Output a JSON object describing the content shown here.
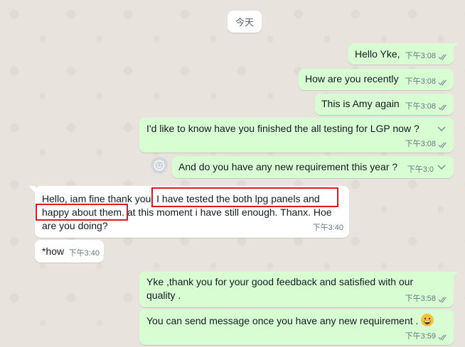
{
  "chat": {
    "date_chip": "今天",
    "messages": [
      {
        "dir": "out",
        "text": "Hello Yke,",
        "time": "下午3:08"
      },
      {
        "dir": "out",
        "text": "How are you recently",
        "time": "下午3:08"
      },
      {
        "dir": "out",
        "text": "This is Amy again",
        "time": "下午3:08"
      },
      {
        "dir": "out",
        "text": "I'd like to know have you finished the all testing for LGP now ?",
        "time": "下午3:08"
      },
      {
        "dir": "out",
        "text": "And do you have any new requirement this year ?",
        "time": "下午3:0"
      },
      {
        "dir": "in",
        "lines": [
          "Hello, iam fine thank you. I have tested the both lpg panels and",
          "happy about them. at this moment i have still enough. Thanx. Hoe",
          "are you doing?"
        ],
        "time": "下午3:40"
      },
      {
        "dir": "in",
        "text": "*how",
        "time": "下午3:40"
      },
      {
        "dir": "out",
        "lines": [
          "Yke ,thank you for your good feedback and satisfied with our",
          "quality ."
        ],
        "time": "下午3:58"
      },
      {
        "dir": "out",
        "text": "You can send message once you have any new requirement .",
        "time": "下午3:59"
      }
    ]
  },
  "icons": {
    "read_ticks": "double-check-icon",
    "menu_chevron": "chevron-down-icon",
    "react": "emoji-react-icon",
    "emoji": "grinning-face-icon"
  },
  "colors": {
    "outgoing_bubble": "#d9fdd3",
    "incoming_bubble": "#ffffff",
    "annotation": "#e0191e",
    "ticks": "#8696a0"
  }
}
